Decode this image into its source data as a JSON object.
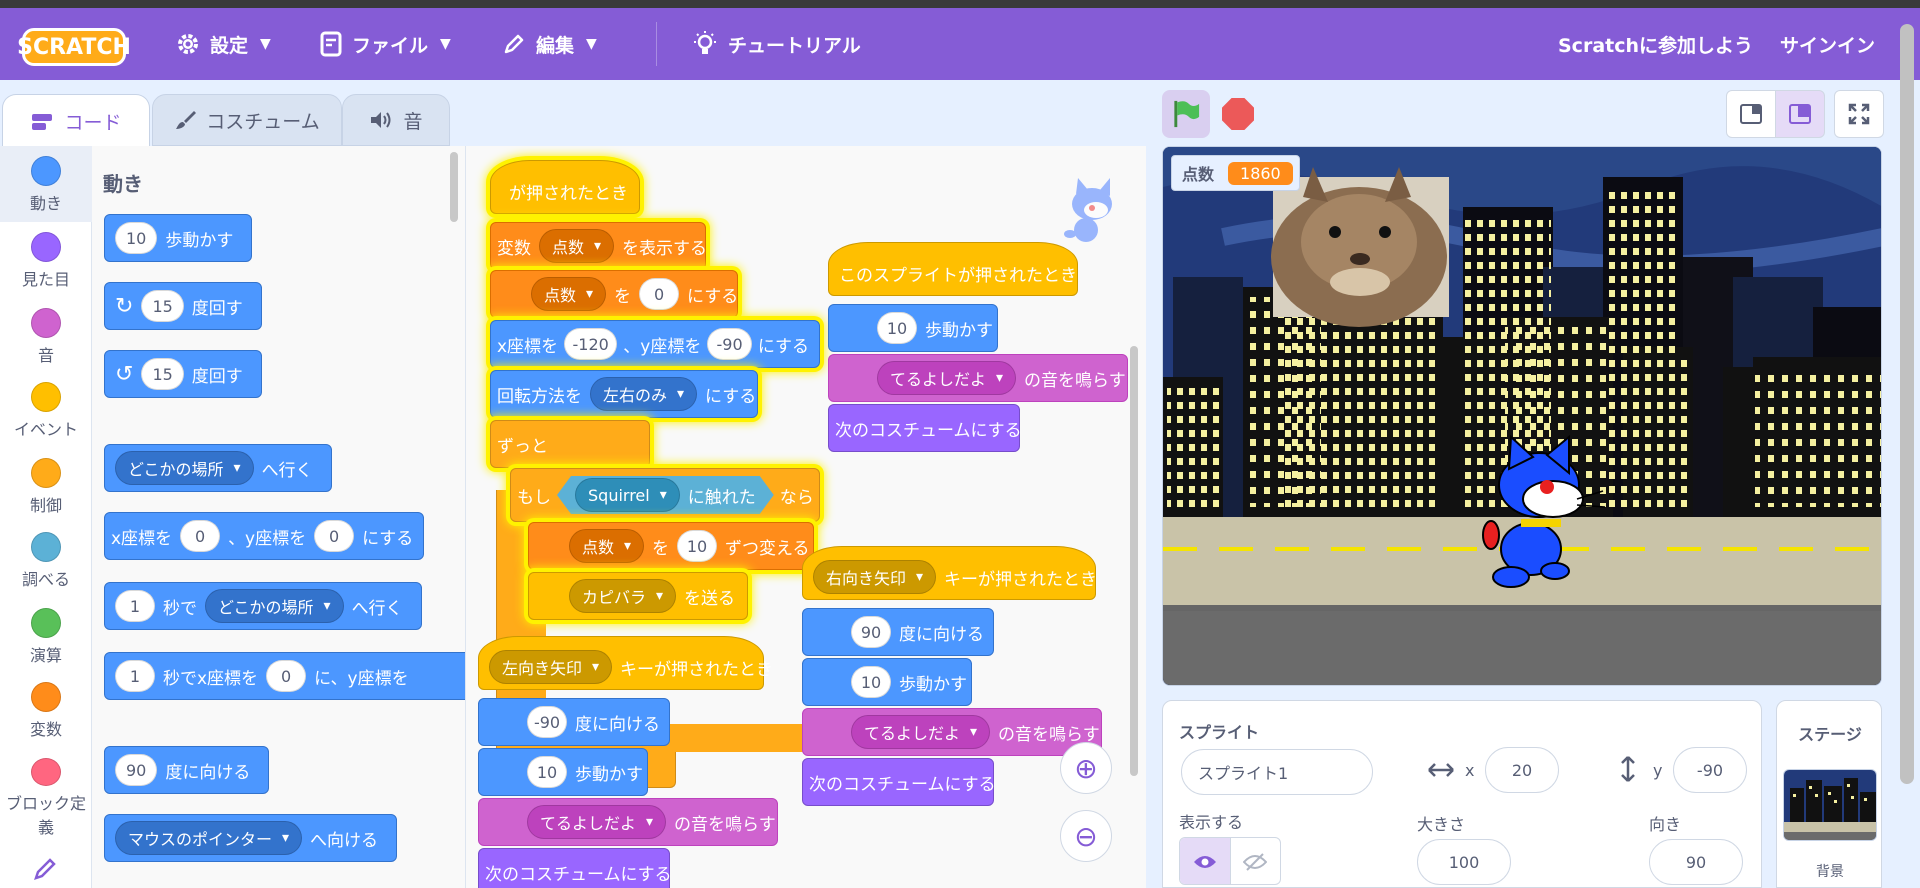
{
  "menubar": {
    "logo": "SCRATCH",
    "settings": "設定",
    "file": "ファイル",
    "edit": "編集",
    "tutorial": "チュートリアル",
    "join": "Scratchに参加しよう",
    "signin": "サインイン"
  },
  "tabs": {
    "code": "コード",
    "costume": "コスチューム",
    "sound": "音"
  },
  "categories": [
    {
      "label": "動き",
      "color": "#4c97ff"
    },
    {
      "label": "見た目",
      "color": "#9966ff"
    },
    {
      "label": "音",
      "color": "#cf63cf"
    },
    {
      "label": "イベント",
      "color": "#ffbf00"
    },
    {
      "label": "制御",
      "color": "#ffab19"
    },
    {
      "label": "調べる",
      "color": "#5cb1d6"
    },
    {
      "label": "演算",
      "color": "#59c059"
    },
    {
      "label": "変数",
      "color": "#ff8c1a"
    },
    {
      "label": "ブロック定義",
      "color": "#ff6680"
    }
  ],
  "palette": {
    "title": "動き",
    "move_n": "10",
    "move_t": "歩動かす",
    "turn_r_n": "15",
    "turn_r_t": "度回す",
    "turn_l_n": "15",
    "turn_l_t": "度回す",
    "goto_d": "どこかの場所",
    "goto_t": "へ行く",
    "setxy_a": "x座標を",
    "setxy_x": "0",
    "setxy_b": "、y座標を",
    "setxy_y": "0",
    "setxy_c": "にする",
    "glide_n": "1",
    "glide_a": "秒で",
    "glide_d": "どこかの場所",
    "glide_t": "へ行く",
    "glidexy_n": "1",
    "glidexy_a": "秒でx座標を",
    "glidexy_x": "0",
    "glidexy_b": "に、y座標を",
    "point_n": "90",
    "point_t": "度に向ける",
    "towards_d": "マウスのポインター",
    "towards_t": "へ向ける"
  },
  "script1": {
    "hat": "が押されたとき",
    "show_a": "変数",
    "show_d": "点数",
    "show_b": "を表示する",
    "set_d": "点数",
    "set_a": "を",
    "set_v": "0",
    "set_b": "にする",
    "xy_a": "x座標を",
    "xy_x": "-120",
    "xy_b": "、y座標を",
    "xy_y": "-90",
    "xy_c": "にする",
    "rot_a": "回転方法を",
    "rot_d": "左右のみ",
    "rot_b": "にする",
    "forever": "ずっと",
    "if_a": "もし",
    "if_d": "Squirrel",
    "if_b": "に触れた",
    "if_c": "なら",
    "chg_d": "点数",
    "chg_a": "を",
    "chg_v": "10",
    "chg_b": "ずつ変える",
    "bc_d": "カピバラ",
    "bc_b": "を送る"
  },
  "script2": {
    "hat": "このスプライトが押されたとき",
    "move_n": "10",
    "move_t": "歩動かす",
    "snd_d": "てるよしだよ",
    "snd_t": "の音を鳴らす",
    "next": "次のコスチュームにする"
  },
  "script3": {
    "key_d": "右向き矢印",
    "key_t": "キーが押されたとき",
    "dir_n": "90",
    "dir_t": "度に向ける",
    "move_n": "10",
    "move_t": "歩動かす",
    "snd_d": "てるよしだよ",
    "snd_t": "の音を鳴らす",
    "next": "次のコスチュームにする"
  },
  "script4": {
    "key_d": "左向き矢印",
    "key_t": "キーが押されたとき",
    "dir_n": "-90",
    "dir_t": "度に向ける",
    "move_n": "10",
    "move_t": "歩動かす",
    "snd_d": "てるよしだよ",
    "snd_t": "の音を鳴らす",
    "next": "次のコスチュームにする"
  },
  "stage": {
    "monitor_label": "点数",
    "monitor_value": "1860"
  },
  "sprite": {
    "title": "スプライト",
    "name": "スプライト1",
    "x_label": "x",
    "x": "20",
    "y_label": "y",
    "y": "-90",
    "show_label": "表示する",
    "size_label": "大きさ",
    "size": "100",
    "dir_label": "向き",
    "dir": "90"
  },
  "stagepanel": {
    "title": "ステージ",
    "backdrop": "背景"
  }
}
